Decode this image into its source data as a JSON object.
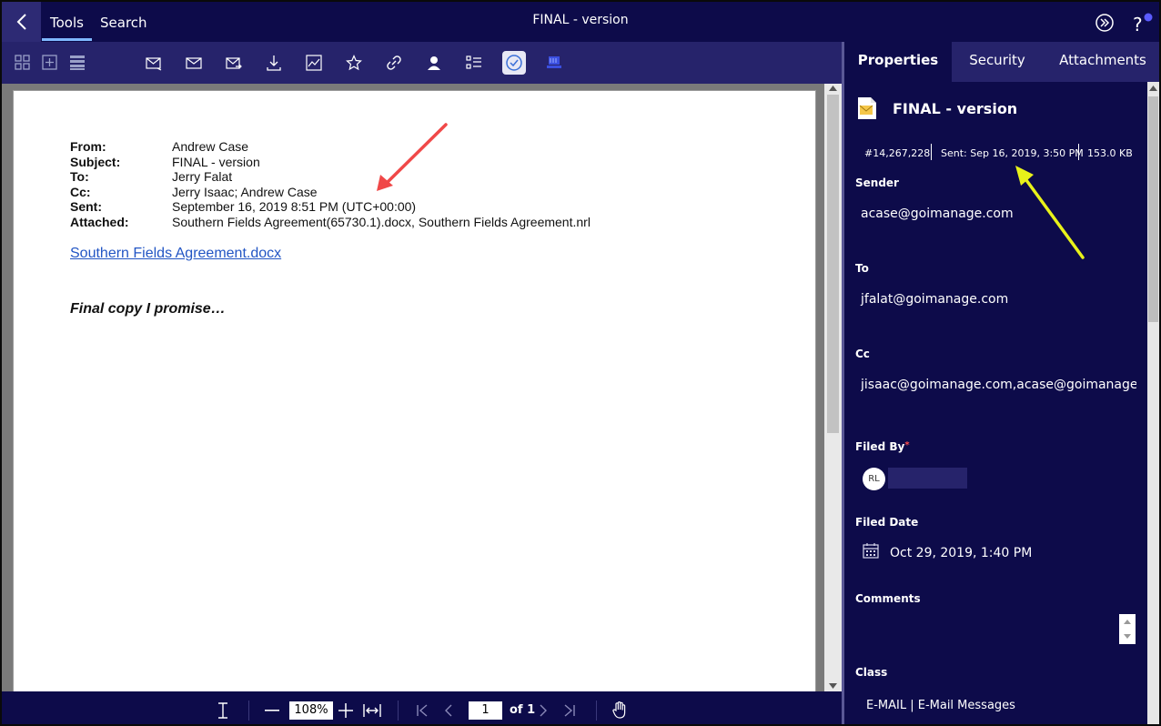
{
  "topbar": {
    "back_icon": "chevron-left-icon",
    "tabs": [
      "Tools",
      "Search"
    ],
    "window_title": "FINAL - version",
    "right_icons": [
      "double-chevron-right-icon",
      "help-icon"
    ]
  },
  "toolbar": {
    "icons": [
      "grid-view-icon",
      "add-icon",
      "list-view-icon",
      "email-in-icon",
      "email-icon",
      "email-send-icon",
      "download-icon",
      "chart-icon",
      "star-icon",
      "link-icon",
      "user-icon",
      "checklist-icon",
      "check-circle-icon",
      "stamp-icon"
    ]
  },
  "document": {
    "headers": [
      {
        "label": "From:",
        "value": "Andrew Case"
      },
      {
        "label": "Subject:",
        "value": "FINAL - version"
      },
      {
        "label": "To:",
        "value": "Jerry Falat"
      },
      {
        "label": "Cc:",
        "value": "Jerry Isaac; Andrew Case"
      },
      {
        "label": "Sent:",
        "value": "September 16, 2019 8:51 PM (UTC+00:00)"
      },
      {
        "label": "Attached:",
        "value": "Southern Fields Agreement(65730.1).docx, Southern Fields Agreement.nrl"
      }
    ],
    "link": "Southern Fields Agreement.docx",
    "body": "Final copy I promise…"
  },
  "bottombar": {
    "zoom": "108%",
    "page": "1",
    "of_label": "of 1"
  },
  "panel": {
    "tabs": [
      "Properties",
      "Security",
      "Attachments"
    ],
    "title": "FINAL - version",
    "doc_number": "#14,267,228",
    "sent": "Sent: Sep 16, 2019, 3:50 PM",
    "size": "153.0 KB",
    "sender_label": "Sender",
    "sender": "acase@goimanage.com",
    "to_label": "To",
    "to": "jfalat@goimanage.com",
    "cc_label": "Cc",
    "cc": "jisaac@goimanage.com,acase@goimanage.com",
    "filed_by_label": "Filed By",
    "filed_by_star": "*",
    "filed_by_initials": "RL",
    "filed_date_label": "Filed Date",
    "filed_date": "Oct 29, 2019, 1:40 PM",
    "comments_label": "Comments",
    "class_label": "Class",
    "class_value": "E-MAIL | E-Mail Messages"
  },
  "colors": {
    "navy": "#0d0b4a",
    "toolbar": "#26236b",
    "accent_tab": "#7fb8ff",
    "notification_dot": "#5b5bff",
    "annotation_red": "#f04848",
    "annotation_yellow": "#e8f21a"
  }
}
